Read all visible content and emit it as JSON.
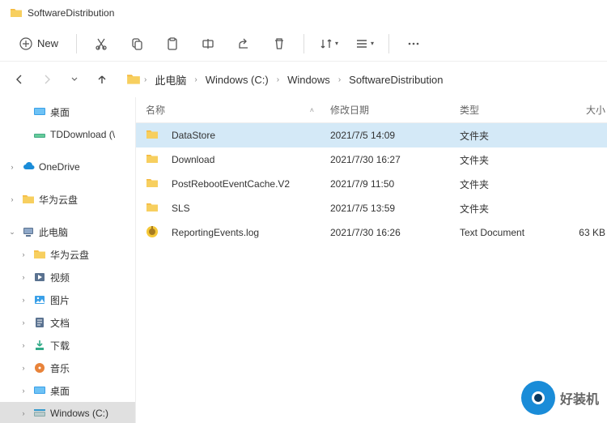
{
  "window": {
    "title": "SoftwareDistribution"
  },
  "toolbar": {
    "new_label": "New"
  },
  "breadcrumb": {
    "items": [
      {
        "label": "此电脑"
      },
      {
        "label": "Windows (C:)"
      },
      {
        "label": "Windows"
      },
      {
        "label": "SoftwareDistribution"
      }
    ]
  },
  "sidebar": {
    "items": [
      {
        "label": "桌面",
        "indent": 1,
        "chev": "",
        "icon": "desktop"
      },
      {
        "label": "TDDownload (\\",
        "indent": 1,
        "chev": "",
        "icon": "netdrive"
      },
      {
        "gap": true
      },
      {
        "label": "OneDrive",
        "indent": 0,
        "chev": "›",
        "icon": "cloud"
      },
      {
        "gap": true
      },
      {
        "label": "华为云盘",
        "indent": 0,
        "chev": "›",
        "icon": "folder"
      },
      {
        "gap": true
      },
      {
        "label": "此电脑",
        "indent": 0,
        "chev": "⌄",
        "icon": "pc"
      },
      {
        "label": "华为云盘",
        "indent": 1,
        "chev": "›",
        "icon": "folder"
      },
      {
        "label": "视频",
        "indent": 1,
        "chev": "›",
        "icon": "video"
      },
      {
        "label": "图片",
        "indent": 1,
        "chev": "›",
        "icon": "pictures"
      },
      {
        "label": "文档",
        "indent": 1,
        "chev": "›",
        "icon": "docs"
      },
      {
        "label": "下载",
        "indent": 1,
        "chev": "›",
        "icon": "downloads"
      },
      {
        "label": "音乐",
        "indent": 1,
        "chev": "›",
        "icon": "music"
      },
      {
        "label": "桌面",
        "indent": 1,
        "chev": "›",
        "icon": "desktop"
      },
      {
        "label": "Windows (C:)",
        "indent": 1,
        "chev": "›",
        "icon": "drive",
        "selected": true
      }
    ]
  },
  "columns": {
    "name": "名称",
    "date": "修改日期",
    "type": "类型",
    "size": "大小"
  },
  "files": [
    {
      "name": "DataStore",
      "date": "2021/7/5 14:09",
      "type": "文件夹",
      "size": "",
      "icon": "folder",
      "selected": true
    },
    {
      "name": "Download",
      "date": "2021/7/30 16:27",
      "type": "文件夹",
      "size": "",
      "icon": "folder"
    },
    {
      "name": "PostRebootEventCache.V2",
      "date": "2021/7/9 11:50",
      "type": "文件夹",
      "size": "",
      "icon": "folder"
    },
    {
      "name": "SLS",
      "date": "2021/7/5 13:59",
      "type": "文件夹",
      "size": "",
      "icon": "folder"
    },
    {
      "name": "ReportingEvents.log",
      "date": "2021/7/30 16:26",
      "type": "Text Document",
      "size": "63 KB",
      "icon": "log"
    }
  ],
  "watermark": {
    "text": "好装机"
  }
}
